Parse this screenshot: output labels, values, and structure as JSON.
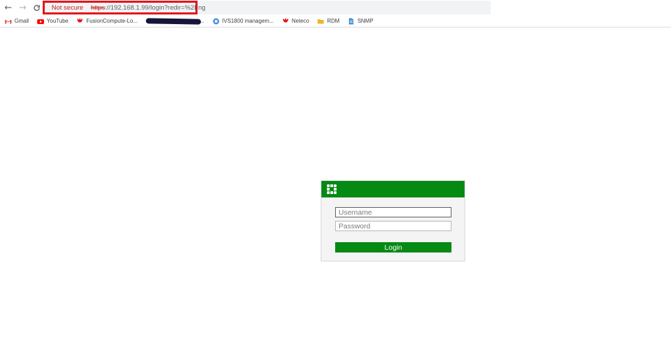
{
  "browser": {
    "security_label": "Not secure",
    "url_scheme": "https",
    "url_rest": "://192.168.1.99/login?redir=%2Fng",
    "nav_icons": [
      "back-arrow-icon",
      "forward-arrow-icon",
      "reload-icon"
    ],
    "highlight_color": "#e4131b"
  },
  "bookmarks": [
    {
      "label": "Gmail",
      "icon": "gmail-icon"
    },
    {
      "label": "YouTube",
      "icon": "youtube-icon"
    },
    {
      "label": "FusionCompute-Lo...",
      "icon": "huawei-icon"
    },
    {
      "label": "...",
      "icon": "redacted"
    },
    {
      "label": "IVS1800 managem...",
      "icon": "globe-icon"
    },
    {
      "label": "Neteco",
      "icon": "huawei-icon"
    },
    {
      "label": "RDM",
      "icon": "folder-icon"
    },
    {
      "label": "SNMP",
      "icon": "document-icon"
    }
  ],
  "login": {
    "username_placeholder": "Username",
    "password_placeholder": "Password",
    "button_label": "Login",
    "brand_color": "#058a13"
  }
}
